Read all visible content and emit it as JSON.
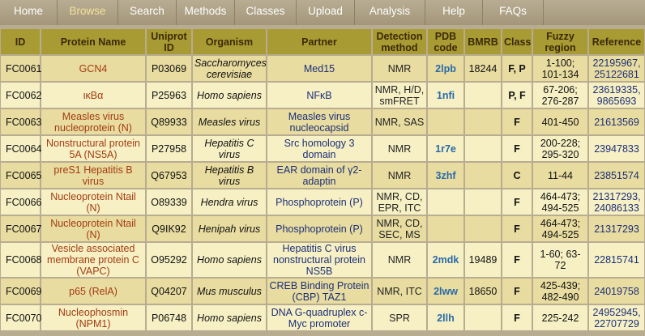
{
  "nav": [
    "Home",
    "Browse",
    "Search",
    "Methods",
    "Classes",
    "Upload",
    "Analysis",
    "Help",
    "FAQs"
  ],
  "headers": [
    "ID",
    "Protein Name",
    "Uniprot ID",
    "Organism",
    "Partner",
    "Detection method",
    "PDB code",
    "BMRB",
    "Class",
    "Fuzzy region",
    "Reference"
  ],
  "rows": [
    {
      "id": "FC0061",
      "protein": "GCN4",
      "uniprot": "P03069",
      "organism": "Saccharomyces cerevisiae",
      "partner": "Med15",
      "method": "NMR",
      "pdb": "2lpb",
      "bmrb": "18244",
      "class": "F, P",
      "region": "1-100; 101-134",
      "ref": "22195967, 25122681"
    },
    {
      "id": "FC0062",
      "protein": "ικΒα",
      "uniprot": "P25963",
      "organism": "Homo sapiens",
      "partner": "NFκB",
      "method": "NMR, H/D, smFRET",
      "pdb": "1nfi",
      "bmrb": "",
      "class": "P, F",
      "region": "67-206; 276-287",
      "ref": "23619335, 9865693"
    },
    {
      "id": "FC0063",
      "protein": "Measles virus nucleoprotein (N)",
      "uniprot": "Q89933",
      "organism": "Measles virus",
      "partner": "Measles virus nucleocapsid",
      "method": "NMR, SAS",
      "pdb": "",
      "bmrb": "",
      "class": "F",
      "region": "401-450",
      "ref": "21613569"
    },
    {
      "id": "FC0064",
      "protein": "Nonstructural protein 5A (NS5A)",
      "uniprot": "P27958",
      "organism": "Hepatitis C virus",
      "partner": "Src homology 3 domain",
      "method": "NMR",
      "pdb": "1r7e",
      "bmrb": "",
      "class": "F",
      "region": "200-228; 295-320",
      "ref": "23947833"
    },
    {
      "id": "FC0065",
      "protein": "preS1 Hepatitis B virus",
      "uniprot": "Q67953",
      "organism": "Hepatitis B virus",
      "partner": "EAR domain of γ2-adaptin",
      "method": "NMR",
      "pdb": "3zhf",
      "bmrb": "",
      "class": "C",
      "region": "11-44",
      "ref": "23851574"
    },
    {
      "id": "FC0066",
      "protein": "Nucleoprotein Ntail (N)",
      "uniprot": "O89339",
      "organism": "Hendra virus",
      "partner": "Phosphoprotein (P)",
      "method": "NMR, CD, EPR, ITC",
      "pdb": "",
      "bmrb": "",
      "class": "F",
      "region": "464-473; 494-525",
      "ref": "21317293, 24086133"
    },
    {
      "id": "FC0067",
      "protein": "Nucleoprotein Ntail (N)",
      "uniprot": "Q9IK92",
      "organism": "Henipah virus",
      "partner": "Phosphoprotein (P)",
      "method": "NMR, CD, SEC, MS",
      "pdb": "",
      "bmrb": "",
      "class": "F",
      "region": "464-473; 494-525",
      "ref": "21317293"
    },
    {
      "id": "FC0068",
      "protein": "Vesicle associated membrane protein C (VAPC)",
      "uniprot": "O95292",
      "organism": "Homo sapiens",
      "partner": "Hepatitis C virus nonstructural protein NS5B",
      "method": "NMR",
      "pdb": "2mdk",
      "bmrb": "19489",
      "class": "F",
      "region": "1-60; 63-72",
      "ref": "22815741"
    },
    {
      "id": "FC0069",
      "protein": "p65 (RelA)",
      "uniprot": "Q04207",
      "organism": "Mus musculus",
      "partner": "CREB Binding Protein (CBP) TAZ1",
      "method": "NMR, ITC",
      "pdb": "2lww",
      "bmrb": "18650",
      "class": "F",
      "region": "425-439; 482-490",
      "ref": "24019758"
    },
    {
      "id": "FC0070",
      "protein": "Nucleophosmin (NPM1)",
      "uniprot": "P06748",
      "organism": "Homo sapiens",
      "partner": "DNA G-quadruplex c-Myc promoter",
      "method": "SPR",
      "pdb": "2llh",
      "bmrb": "",
      "class": "F",
      "region": "225-242",
      "ref": "24952945, 22707729"
    }
  ]
}
